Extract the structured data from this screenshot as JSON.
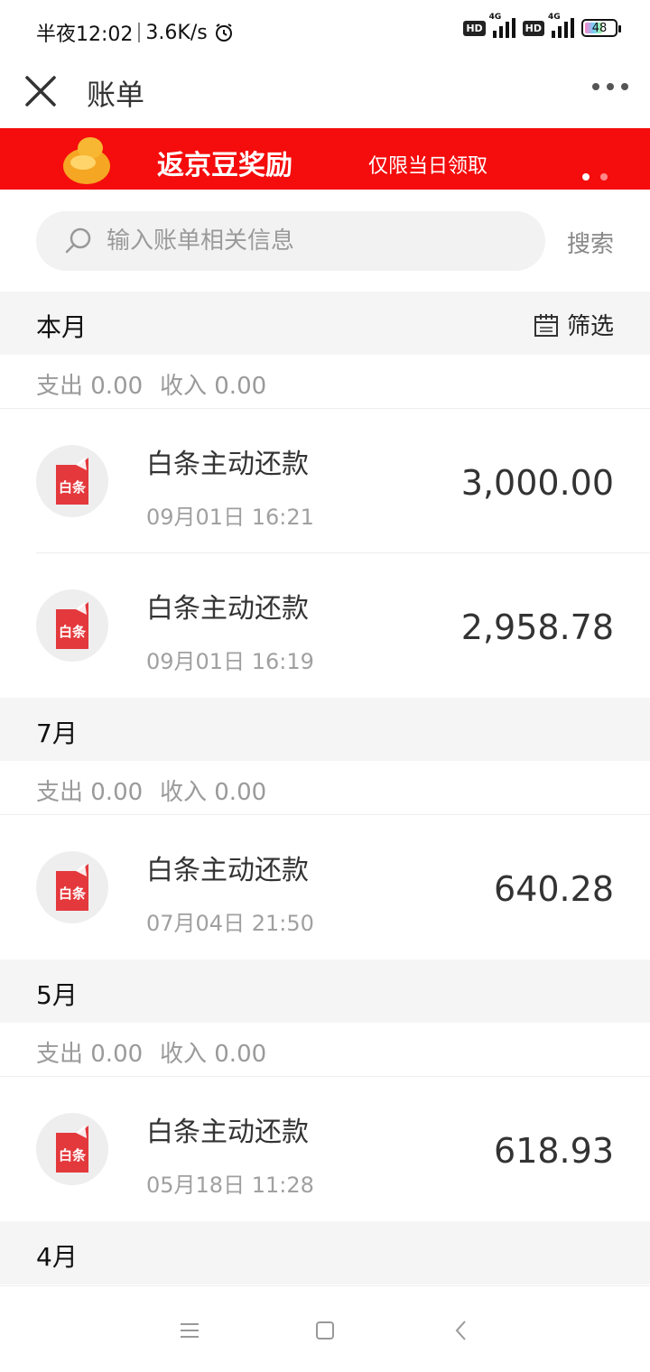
{
  "status_bar": {
    "time": "半夜12:02",
    "speed": "3.6K/s",
    "hd1": "HD",
    "net1": "4G",
    "hd2": "HD",
    "net2": "4G",
    "battery": "48"
  },
  "nav": {
    "title": "账单"
  },
  "banner": {
    "title": "返京豆奖励",
    "subtitle": "仅限当日领取"
  },
  "search": {
    "placeholder": "输入账单相关信息",
    "button_label": "搜索"
  },
  "filter_label": "筛选",
  "groups": [
    {
      "month": "本月",
      "expense": "支出 0.00",
      "income": "收入 0.00",
      "items": [
        {
          "title": "白条主动还款",
          "time": "09月01日 16:21",
          "amount": "3,000.00",
          "icon_text": "白条"
        },
        {
          "title": "白条主动还款",
          "time": "09月01日 16:19",
          "amount": "2,958.78",
          "icon_text": "白条"
        }
      ]
    },
    {
      "month": "7月",
      "expense": "支出 0.00",
      "income": "收入 0.00",
      "items": [
        {
          "title": "白条主动还款",
          "time": "07月04日 21:50",
          "amount": "640.28",
          "icon_text": "白条"
        }
      ]
    },
    {
      "month": "5月",
      "expense": "支出 0.00",
      "income": "收入 0.00",
      "items": [
        {
          "title": "白条主动还款",
          "time": "05月18日 11:28",
          "amount": "618.93",
          "icon_text": "白条"
        }
      ]
    },
    {
      "month": "4月"
    }
  ],
  "colors": {
    "banner_bg": "#f50c0c",
    "baitiao_red": "#e4393c",
    "section_bg": "#f5f5f5"
  },
  "icons": {
    "close": "close-icon",
    "more": "more-dots-icon",
    "search": "search-icon",
    "filter": "calendar-filter-icon",
    "bean": "jingdou-bean-icon",
    "item": "baitiao-icon",
    "nav_menu": "menu-icon",
    "nav_home": "home-square-icon",
    "nav_back": "back-chevron-icon"
  }
}
